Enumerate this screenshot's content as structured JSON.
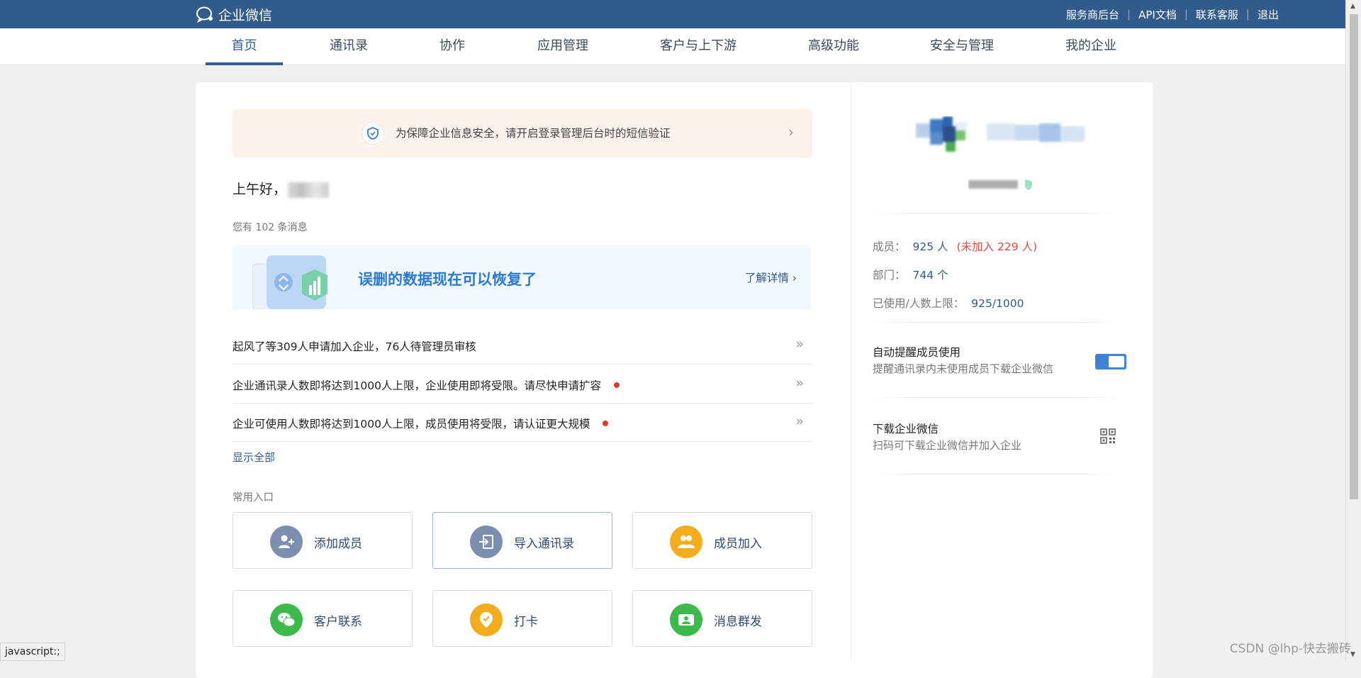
{
  "brand": {
    "name": "企业微信"
  },
  "toplinks": [
    "服务商后台",
    "API文档",
    "联系客服",
    "退出"
  ],
  "nav": {
    "tabs": [
      "首页",
      "通讯录",
      "协作",
      "应用管理",
      "客户与上下游",
      "高级功能",
      "安全与管理",
      "我的企业"
    ],
    "active": 0
  },
  "alert": {
    "text": "为保障企业信息安全，请开启登录管理后台时的短信验证",
    "chevron": "›"
  },
  "greeting": {
    "prefix": "上午好，"
  },
  "messages": {
    "text": "您有 102 条消息"
  },
  "banner": {
    "title": "误删的数据现在可以恢复了",
    "link": "了解详情 ›"
  },
  "notices": [
    {
      "text": "起风了等309人申请加入企业，76人待管理员审核",
      "red_dot": false
    },
    {
      "text": "企业通讯录人数即将达到1000人上限，企业使用即将受限。请尽快申请扩容",
      "red_dot": true
    },
    {
      "text": "企业可使用人数即将达到1000人上限，成员使用将受限，请认证更大规模",
      "red_dot": true
    }
  ],
  "notice_arrow": "»",
  "show_all": "显示全部",
  "common_entries": {
    "title": "常用入口",
    "items": [
      {
        "label": "添加成员",
        "icon": "add-member-icon",
        "color": "#7c8fb0"
      },
      {
        "label": "导入通讯录",
        "icon": "import-contacts-icon",
        "color": "#7c8fb0"
      },
      {
        "label": "成员加入",
        "icon": "member-join-icon",
        "color": "#f3ad1c"
      },
      {
        "label": "客户联系",
        "icon": "wechat-icon",
        "color": "#3cbb4c"
      },
      {
        "label": "打卡",
        "icon": "checkin-icon",
        "color": "#f3ad1c"
      },
      {
        "label": "消息群发",
        "icon": "broadcast-icon",
        "color": "#3cbb4c"
      }
    ]
  },
  "stats": {
    "members_label": "成员：",
    "members_value": "925 人",
    "members_warn": "(未加入 229 人)",
    "departments_label": "部门：",
    "departments_value": "744 个",
    "limit_label": "已使用/人数上限：",
    "limit_value": "925/1000"
  },
  "options": {
    "auto_remind_title": "自动提醒成员使用",
    "auto_remind_sub": "提醒通讯录内未使用成员下载企业微信",
    "auto_remind_on": true,
    "download_title": "下载企业微信",
    "download_sub": "扫码可下载企业微信并加入企业"
  },
  "statusbar": "javascript:;",
  "watermark": "CSDN @lhp-快去搬砖"
}
